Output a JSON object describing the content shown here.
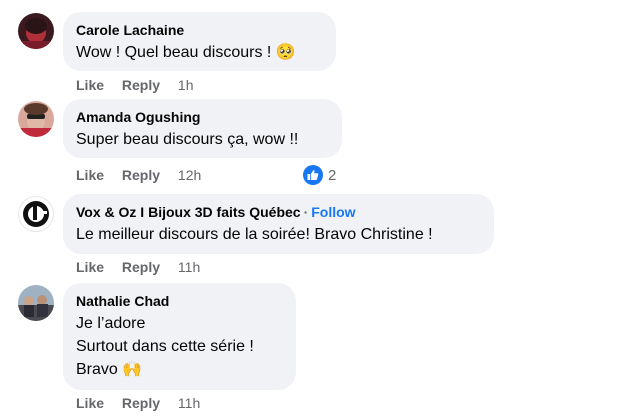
{
  "comments": [
    {
      "author": "Carole Lachaine",
      "lines": [
        "Wow ! Quel beau discours ! 🥺"
      ],
      "actions": {
        "like": "Like",
        "reply": "Reply",
        "time": "1h"
      }
    },
    {
      "author": "Amanda Ogushing",
      "lines": [
        "Super beau discours ça, wow !!"
      ],
      "actions": {
        "like": "Like",
        "reply": "Reply",
        "time": "12h"
      },
      "reactions": {
        "count": "2",
        "icon": "like-icon",
        "color": "#1877f2"
      }
    },
    {
      "author": "Vox & Oz I Bijoux 3D faits Québec",
      "separator": "·",
      "follow": "Follow",
      "lines": [
        "Le meilleur discours de la soirée! Bravo Christine !"
      ],
      "actions": {
        "like": "Like",
        "reply": "Reply",
        "time": "11h"
      }
    },
    {
      "author": "Nathalie Chad",
      "lines": [
        "Je l’adore",
        "Surtout dans cette série !",
        "Bravo 🙌"
      ],
      "actions": {
        "like": "Like",
        "reply": "Reply",
        "time": "11h"
      }
    }
  ],
  "colors": {
    "bubble": "#f0f2f5",
    "meta": "#65676b",
    "accent": "#1877f2"
  }
}
